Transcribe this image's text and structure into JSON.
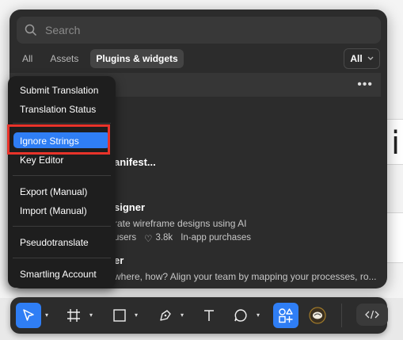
{
  "search": {
    "placeholder": "Search"
  },
  "tabs": [
    {
      "label": "All"
    },
    {
      "label": "Assets"
    },
    {
      "label": "Plugins & widgets",
      "active": true
    }
  ],
  "filter": {
    "value": "All"
  },
  "list": {
    "items": [
      {
        "title": "anifest..."
      },
      {
        "title": "signer",
        "description": "rate wireframe designs using AI",
        "users": "users",
        "likes": "3.8k",
        "pricing": "In-app purchases"
      },
      {
        "title": "er",
        "description": "where, how? Align your team by mapping your processes, ro..."
      }
    ]
  },
  "context_menu": {
    "items": [
      {
        "label": "Submit Translation"
      },
      {
        "label": "Translation Status"
      },
      {
        "label": "Ignore Strings",
        "highlighted": true
      },
      {
        "label": "Key Editor"
      },
      {
        "label": "Export (Manual)"
      },
      {
        "label": "Import (Manual)"
      },
      {
        "label": "Pseudotranslate"
      },
      {
        "label": "Smartling Account"
      }
    ]
  },
  "canvas": {
    "cursor_text": "i"
  },
  "toolbar": {
    "tools": [
      "move-tool",
      "frame-tool",
      "shape-tool",
      "pen-tool",
      "text-tool",
      "comment-tool",
      "actions-tool",
      "plugin-avatar",
      "dev-mode"
    ]
  },
  "colors": {
    "accent": "#2f7ef5",
    "panel": "#2c2c2c",
    "menu": "#1e1e1e",
    "highlight_border": "#e8332a"
  }
}
